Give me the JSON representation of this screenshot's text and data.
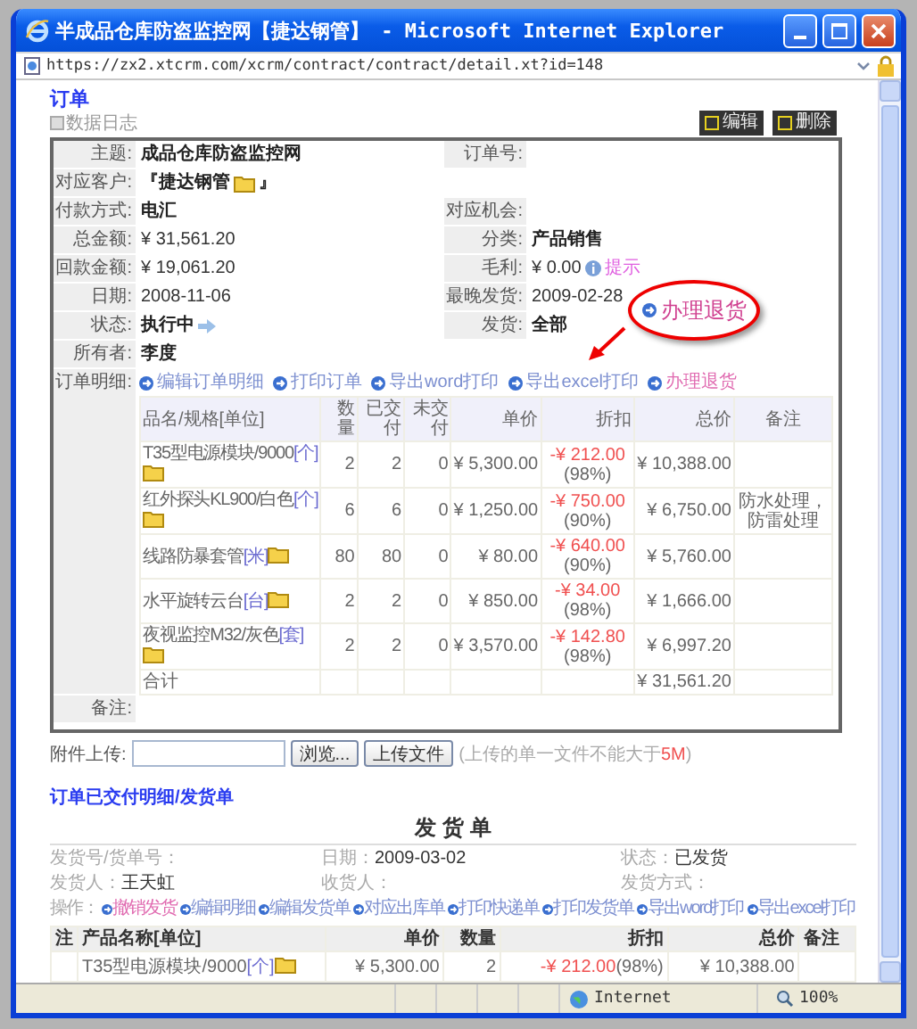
{
  "window": {
    "title": "半成品仓库防盗监控网【捷达钢管】 - Microsoft Internet Explorer",
    "url": "https://zx2.xtcrm.com/xcrm/contract/contract/detail.xt?id=148"
  },
  "page_title": "订单",
  "data_log": "数据日志",
  "actions": [
    "编辑",
    "删除"
  ],
  "detail_rows": [
    [
      {
        "label": "主题:",
        "value": "成品仓库防盗监控网",
        "bold": true,
        "kind": "text"
      },
      {
        "label": "订单号:",
        "kind": "text"
      }
    ],
    [
      {
        "label": "对应客户:",
        "value": "捷达钢管",
        "prefix": "『",
        "suffix": "』",
        "bold": true,
        "kind": "customer"
      }
    ],
    [
      {
        "label": "付款方式:",
        "value": "电汇",
        "bold": true,
        "kind": "text"
      },
      {
        "label": "对应机会:",
        "kind": "text"
      }
    ],
    [
      {
        "label": "总金额:",
        "value": "¥ 31,561.20",
        "bold": false,
        "kind": "text"
      },
      {
        "label": "分类:",
        "value": "产品销售",
        "bold": true,
        "kind": "text"
      }
    ],
    [
      {
        "label": "回款金额:",
        "value": "¥ 19,061.20",
        "bold": false,
        "kind": "text"
      },
      {
        "label": "毛利:",
        "value": "¥ 0.00",
        "hint": "提示",
        "bold": false,
        "kind": "profit"
      }
    ],
    [
      {
        "label": "日期:",
        "value": "2008-11-06",
        "bold": false,
        "kind": "text"
      },
      {
        "label": "最晚发货:",
        "value": "2009-02-28",
        "bold": false,
        "kind": "text"
      }
    ],
    [
      {
        "label": "状态:",
        "value": "执行中",
        "bold": true,
        "kind": "status"
      },
      {
        "label": "发货:",
        "value": "全部",
        "bold": true,
        "kind": "text"
      }
    ],
    [
      {
        "label": "所有者:",
        "value": "李度",
        "bold": true,
        "kind": "text"
      }
    ]
  ],
  "callout": {
    "text": "办理退货"
  },
  "order_items": {
    "label": "订单明细:",
    "links": [
      {
        "text": "编辑订单明细",
        "highlight": false
      },
      {
        "text": "打印订单",
        "highlight": false
      },
      {
        "text": "导出word打印",
        "highlight": false
      },
      {
        "text": "导出excel打印",
        "highlight": false
      },
      {
        "text": "办理退货",
        "highlight": true
      }
    ],
    "columns": [
      "品名/规格[单位]",
      "数量",
      "已交付",
      "未交付",
      "单价",
      "折扣",
      "总价",
      "备注"
    ],
    "rows": [
      {
        "name": "T35型电源模块/9000",
        "unit": "[个]",
        "qty": "2",
        "delivered": "2",
        "undelivered": "0",
        "price": "¥ 5,300.00",
        "discount": "-¥ 212.00",
        "rate": "(98%)",
        "total": "¥ 10,388.00"
      },
      {
        "name": "红外探头KL900/白色",
        "unit": "[个]",
        "qty": "6",
        "delivered": "6",
        "undelivered": "0",
        "price": "¥ 1,250.00",
        "discount": "-¥ 750.00",
        "rate": "(90%)",
        "total": "¥ 6,750.00",
        "remark": "防水处理，防雷处理"
      },
      {
        "name": "线路防暴套管",
        "unit": "[米]",
        "qty": "80",
        "delivered": "80",
        "undelivered": "0",
        "price": "¥ 80.00",
        "discount": "-¥ 640.00",
        "rate": "(90%)",
        "total": "¥ 5,760.00"
      },
      {
        "name": "水平旋转云台",
        "unit": "[台]",
        "qty": "2",
        "delivered": "2",
        "undelivered": "0",
        "price": "¥ 850.00",
        "discount": "-¥ 34.00",
        "rate": "(98%)",
        "total": "¥ 1,666.00"
      },
      {
        "name": "夜视监控M32/灰色",
        "unit": "[套]",
        "qty": "2",
        "delivered": "2",
        "undelivered": "0",
        "price": "¥ 3,570.00",
        "discount": "-¥ 142.80",
        "rate": "(98%)",
        "total": "¥ 6,997.20"
      }
    ],
    "total": {
      "label": "合计",
      "value": "¥ 31,561.20"
    }
  },
  "remarks": {
    "label": "备注:"
  },
  "upload": {
    "label": "附件上传:",
    "browse": "浏览...",
    "button": "上传文件",
    "note": "(上传的单一文件不能大于",
    "limit": "5M",
    "note_end": ")"
  },
  "delivery": {
    "link": "订单已交付明细/发货单",
    "title": "发 货 单",
    "info": [
      [
        {
          "label": "发货号/货单号："
        },
        {
          "label": "日期：",
          "value": "2009-03-02"
        },
        {
          "label": "状态：",
          "value": "已发货"
        }
      ],
      [
        {
          "label": "发货人：",
          "value": "王天虹"
        },
        {
          "label": "收货人："
        },
        {
          "label": "发货方式："
        }
      ]
    ],
    "ops_label": "操作：",
    "ops": [
      {
        "text": "撤销发货",
        "highlight": true
      },
      {
        "text": "编辑明细",
        "highlight": false
      },
      {
        "text": "编辑发货单",
        "highlight": false
      },
      {
        "text": "对应出库单",
        "highlight": false
      },
      {
        "text": "打印快递单",
        "highlight": false
      },
      {
        "text": "打印发货单",
        "highlight": false
      },
      {
        "text": "导出word打印",
        "highlight": false
      },
      {
        "text": "导出excel打印",
        "highlight": false
      }
    ],
    "columns": [
      "注",
      "产品名称[单位]",
      "单价",
      "数量",
      "折扣",
      "总价",
      "备注"
    ],
    "rows": [
      {
        "name": "T35型电源模块/9000",
        "unit": "[个]",
        "price": "¥ 5,300.00",
        "qty": "2",
        "discount": "-¥ 212.00",
        "rate": "(98%)",
        "total": "¥ 10,388.00"
      }
    ]
  },
  "status_bar": {
    "zone": "Internet",
    "zoom": "100%"
  }
}
